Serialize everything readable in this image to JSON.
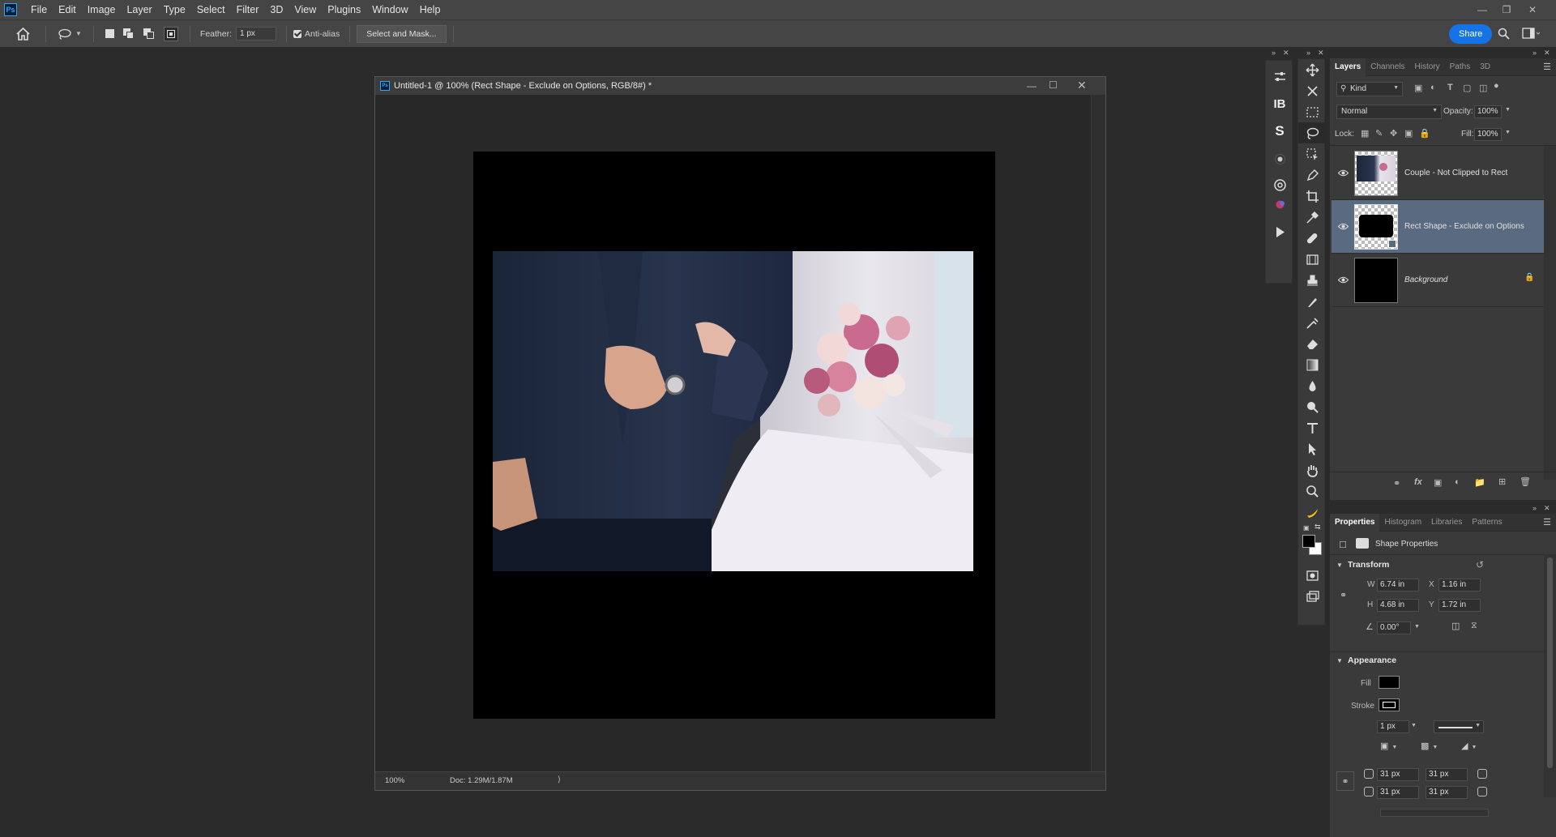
{
  "menubar": {
    "logo": "Ps",
    "items": [
      "File",
      "Edit",
      "Image",
      "Layer",
      "Type",
      "Select",
      "Filter",
      "3D",
      "View",
      "Plugins",
      "Window",
      "Help"
    ]
  },
  "options": {
    "feather_label": "Feather:",
    "feather_value": "1 px",
    "antialias_label": "Anti-alias",
    "select_mask_label": "Select and Mask...",
    "share_label": "Share"
  },
  "document": {
    "title": "Untitled-1 @ 100% (Rect Shape - Exclude on Options, RGB/8#) *",
    "zoom": "100%",
    "doc_info": "Doc: 1.29M/1.87M"
  },
  "layers_panel": {
    "tabs": [
      "Layers",
      "Channels",
      "History",
      "Paths",
      "3D"
    ],
    "filter_kind": "Kind",
    "blend_mode": "Normal",
    "opacity_label": "Opacity:",
    "opacity_value": "100%",
    "lock_label": "Lock:",
    "fill_label": "Fill:",
    "fill_value": "100%",
    "layers": [
      {
        "name": "Couple - Not Clipped to Rect"
      },
      {
        "name": "Rect Shape - Exclude on Options"
      },
      {
        "name": "Background"
      }
    ]
  },
  "properties_panel": {
    "tabs": [
      "Properties",
      "Histogram",
      "Libraries",
      "Patterns"
    ],
    "header": "Shape Properties",
    "transform_label": "Transform",
    "w_label": "W",
    "w_value": "6.74 in",
    "x_label": "X",
    "x_value": "1.16 in",
    "h_label": "H",
    "h_value": "4.68 in",
    "y_label": "Y",
    "y_value": "1.72 in",
    "angle_value": "0.00°",
    "appearance_label": "Appearance",
    "fill_label": "Fill",
    "stroke_label": "Stroke",
    "stroke_width": "1 px",
    "corner_tl": "31 px",
    "corner_tr": "31 px",
    "corner_bl": "31 px",
    "corner_br": "31 px"
  },
  "colors": {
    "accent": "#1473e6",
    "selected_layer": "#5a6a80",
    "panel_bg": "#3a3a3a",
    "app_bg": "#2b2b2b"
  }
}
